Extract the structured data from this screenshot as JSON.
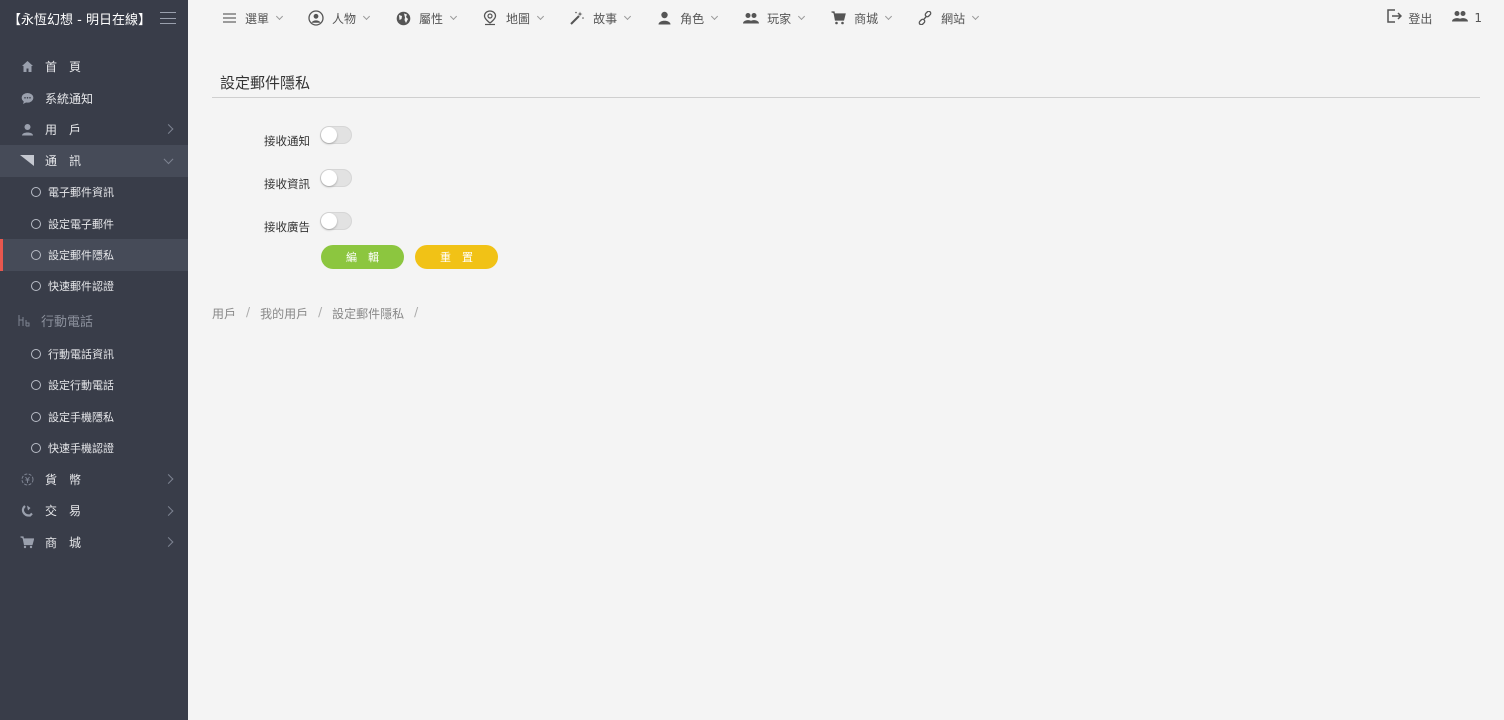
{
  "app": {
    "title": "【永恆幻想 - 明日在線】"
  },
  "sidebar": {
    "items": [
      {
        "label": "首　頁",
        "icon": "home-icon"
      },
      {
        "label": "系統通知",
        "icon": "chat-icon"
      },
      {
        "label": "用　戶",
        "icon": "user-icon"
      },
      {
        "label": "通　訊",
        "icon": "message-icon"
      },
      {
        "label": "貨　幣",
        "icon": "currency-icon"
      },
      {
        "label": "交　易",
        "icon": "exchange-icon"
      },
      {
        "label": "商　城",
        "icon": "cart-icon"
      }
    ],
    "comm_sub": [
      "電子郵件資訊",
      "設定電子郵件",
      "設定郵件隱私",
      "快速郵件認證"
    ],
    "mobile_group": "行動電話",
    "mobile_sub": [
      "行動電話資訊",
      "設定行動電話",
      "設定手機隱私",
      "快速手機認證"
    ]
  },
  "topnav": {
    "items": [
      "選單",
      "人物",
      "屬性",
      "地圖",
      "故事",
      "角色",
      "玩家",
      "商城",
      "網站"
    ],
    "logout": "登出",
    "user_count": "1"
  },
  "main": {
    "title": "設定郵件隱私",
    "fields": [
      {
        "label": "接收通知",
        "on": false
      },
      {
        "label": "接收資訊",
        "on": false
      },
      {
        "label": "接收廣告",
        "on": false
      }
    ],
    "edit_label": "編輯",
    "reset_label": "重置",
    "breadcrumb": [
      "用戶",
      "我的用戶",
      "設定郵件隱私"
    ]
  },
  "colors": {
    "sidebar_bg": "#393d49",
    "active_marker": "#e8574e",
    "edit_button": "#8cc63f",
    "reset_button": "#f1c216"
  }
}
